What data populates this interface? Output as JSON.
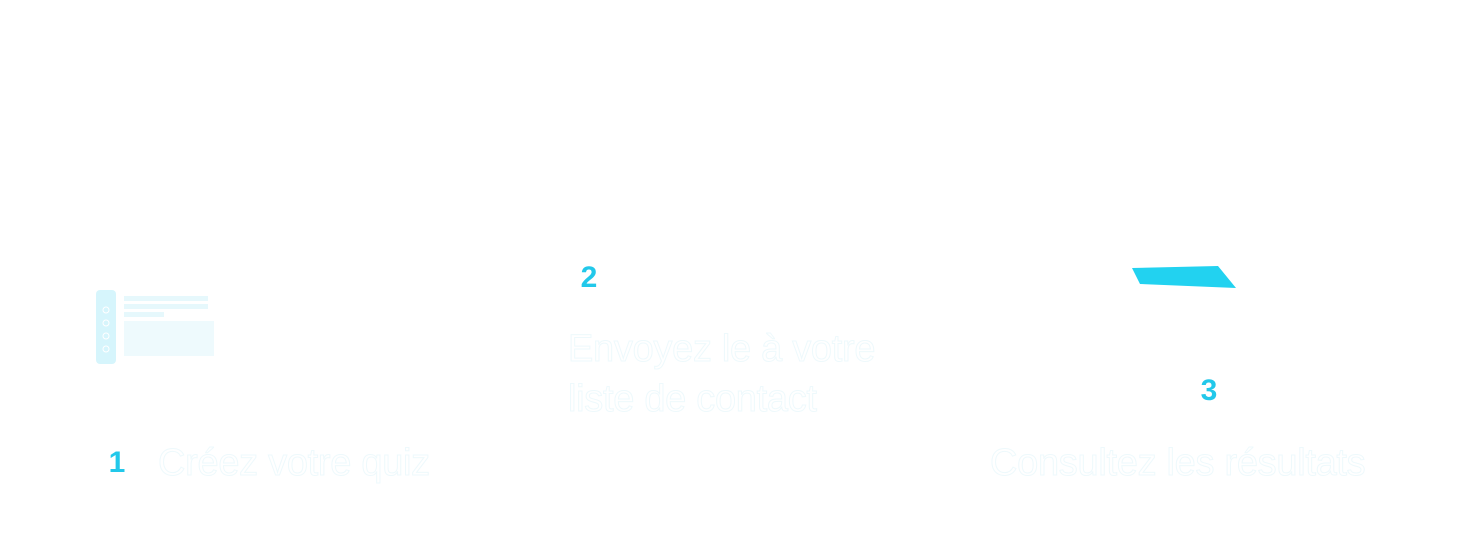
{
  "steps": [
    {
      "number": "1",
      "label": "Créez votre quiz",
      "icon": "laptop-icon"
    },
    {
      "number": "2",
      "label": "Envoyez le à votre liste de contact",
      "icon": "paper-plane-icon"
    },
    {
      "number": "3",
      "label": "Consultez les résultats",
      "icon": "receipt-document-icon"
    }
  ],
  "colors": {
    "accent": "#22c8ea",
    "line": "#ffffff",
    "background": "#ffffff"
  }
}
